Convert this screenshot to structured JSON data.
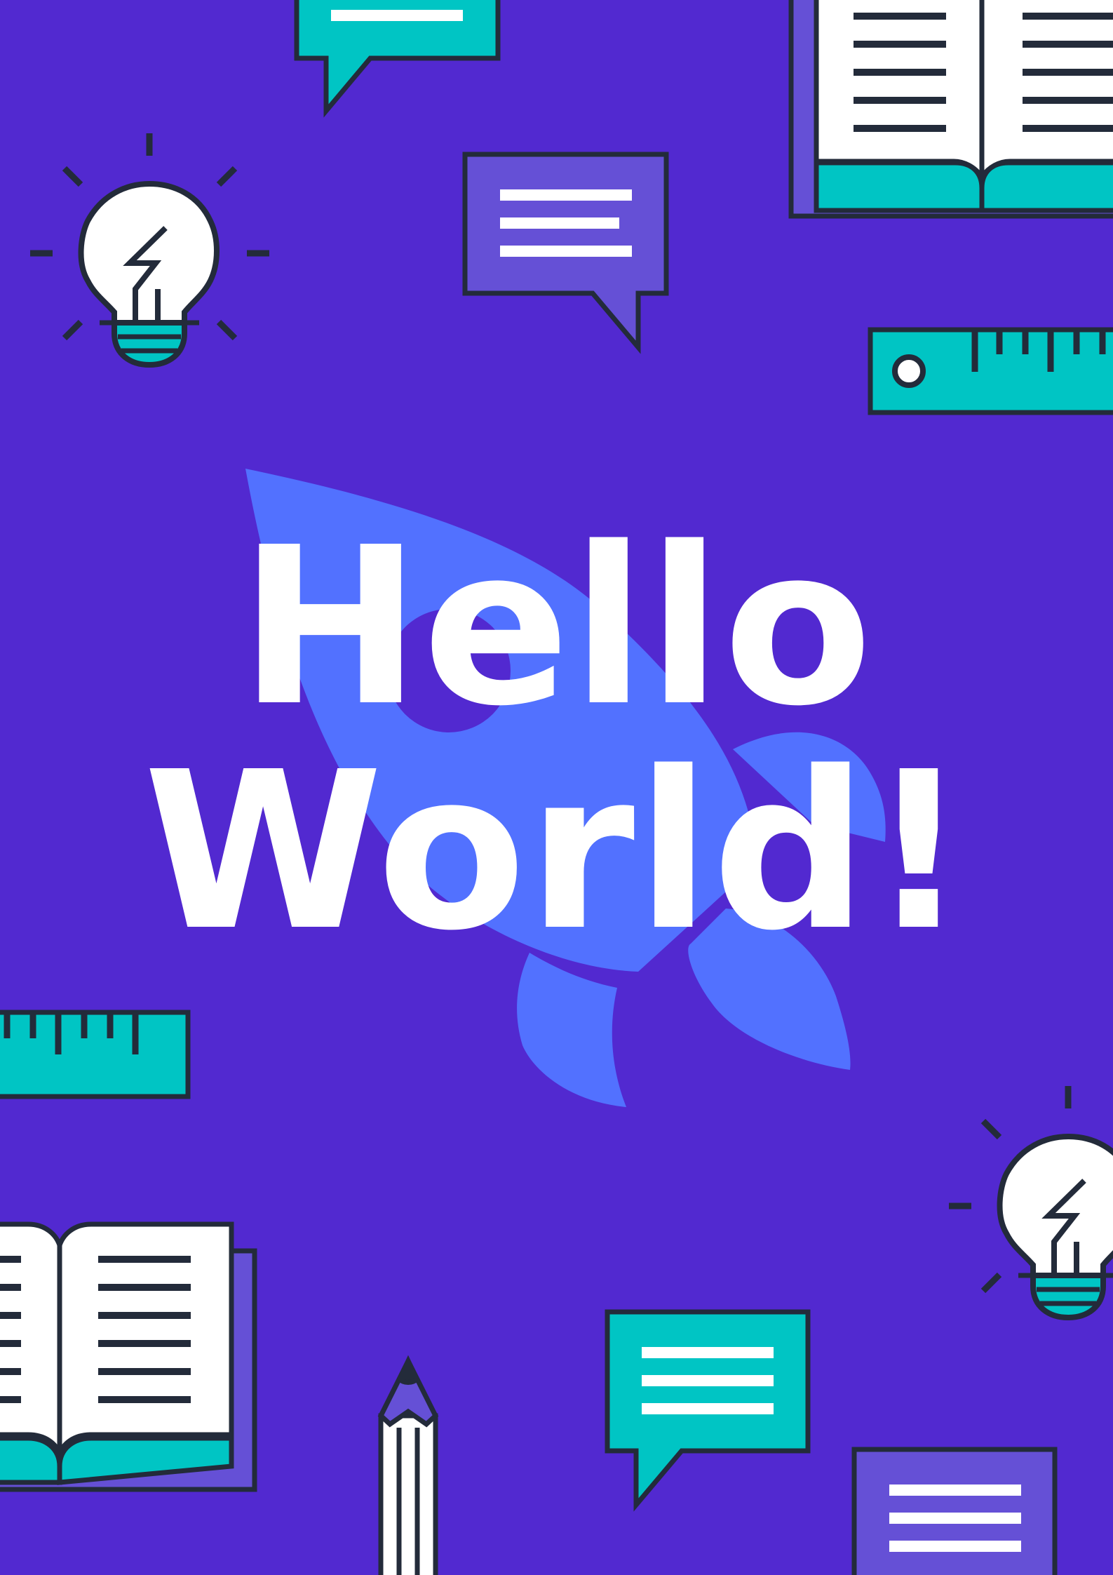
{
  "poster": {
    "headline": {
      "line1": "Hello",
      "line2": "World!"
    },
    "colors": {
      "background": "#5229d0",
      "rocket": "#5271ff",
      "teal": "#00c5c4",
      "purple_panel": "#6550d6",
      "outline": "#232b3a",
      "white": "#ffffff"
    },
    "decorations": [
      "speech-bubble-icon",
      "open-book-icon",
      "light-bulb-icon",
      "ruler-icon",
      "rocket-icon",
      "pencil-icon"
    ]
  }
}
